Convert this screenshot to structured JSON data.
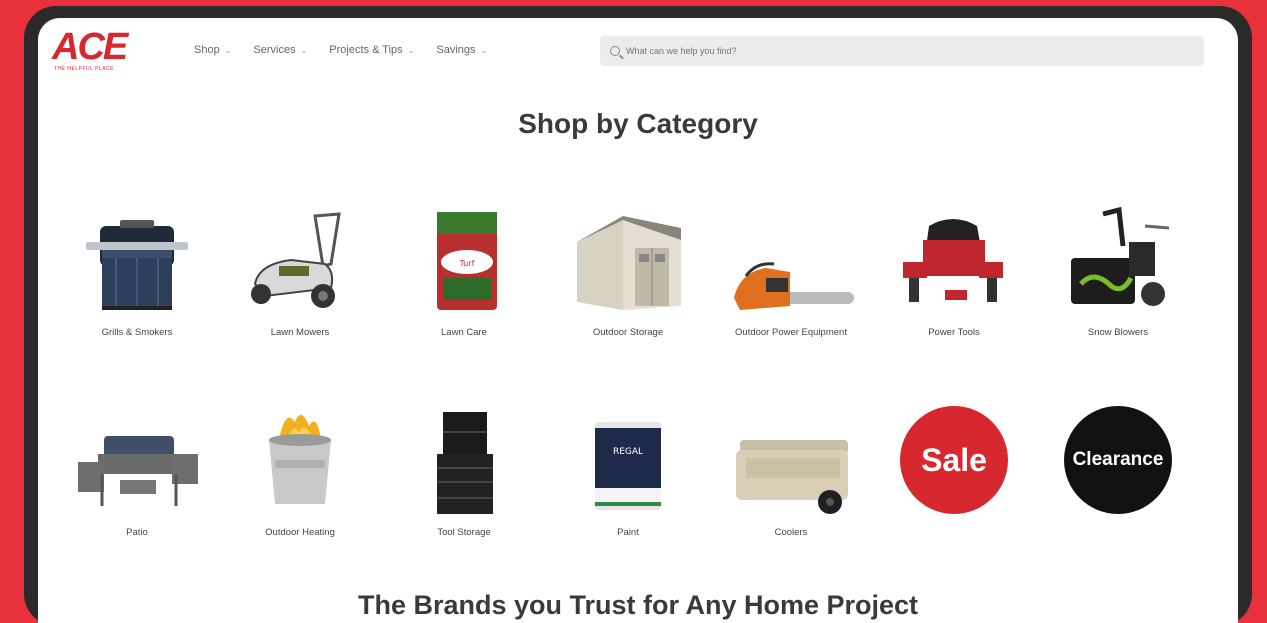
{
  "header": {
    "logo": "ACE",
    "logo_tagline": "THE HELPFUL PLACE",
    "nav": [
      {
        "label": "Shop"
      },
      {
        "label": "Services"
      },
      {
        "label": "Projects & Tips"
      },
      {
        "label": "Savings"
      }
    ],
    "search_placeholder": "What can we help you find?"
  },
  "main": {
    "title": "Shop by Category",
    "categories_row1": [
      {
        "label": "Grills & Smokers",
        "icon": "grill-icon"
      },
      {
        "label": "Lawn Mowers",
        "icon": "lawn-mower-icon"
      },
      {
        "label": "Lawn Care",
        "icon": "lawn-care-bag-icon"
      },
      {
        "label": "Outdoor Storage",
        "icon": "shed-icon"
      },
      {
        "label": "Outdoor Power Equipment",
        "icon": "chainsaw-icon"
      },
      {
        "label": "Power Tools",
        "icon": "power-tools-icon"
      },
      {
        "label": "Snow Blowers",
        "icon": "snow-blower-icon"
      }
    ],
    "categories_row2": [
      {
        "label": "Patio",
        "icon": "patio-furniture-icon"
      },
      {
        "label": "Outdoor Heating",
        "icon": "fire-pit-icon"
      },
      {
        "label": "Tool Storage",
        "icon": "tool-chest-icon"
      },
      {
        "label": "Paint",
        "icon": "paint-can-icon"
      },
      {
        "label": "Coolers",
        "icon": "cooler-icon"
      },
      {
        "label": "Sale",
        "icon": "sale-badge"
      },
      {
        "label": "Clearance",
        "icon": "clearance-badge"
      }
    ],
    "brands_title": "The Brands you Trust for Any Home Project"
  },
  "colors": {
    "brand_red": "#d7282f",
    "frame_red": "#e8313a",
    "clearance_black": "#111111"
  }
}
